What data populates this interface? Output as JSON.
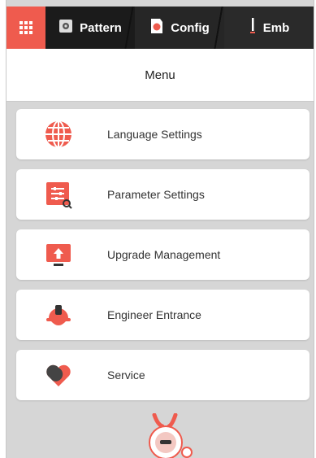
{
  "tabs": [
    {
      "id": "home",
      "label": ""
    },
    {
      "id": "pattern",
      "label": "Pattern"
    },
    {
      "id": "config",
      "label": "Config"
    },
    {
      "id": "emb",
      "label": "Emb"
    }
  ],
  "header": {
    "title": "Menu"
  },
  "menu": {
    "items": [
      {
        "label": "Language Settings",
        "icon": "globe-icon"
      },
      {
        "label": "Parameter Settings",
        "icon": "parameter-icon"
      },
      {
        "label": "Upgrade Management",
        "icon": "upgrade-icon"
      },
      {
        "label": "Engineer Entrance",
        "icon": "hard-hat-icon"
      },
      {
        "label": "Service",
        "icon": "heart-icon"
      }
    ]
  },
  "colors": {
    "accent": "#ef5b4e",
    "tabbar": "#1b1b1b",
    "background": "#d6d6d6"
  }
}
